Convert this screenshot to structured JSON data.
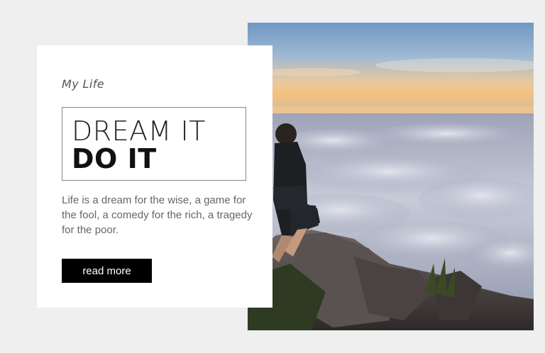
{
  "card": {
    "eyebrow": "My Life",
    "title_line1": "DREAM IT",
    "title_line2": "DO IT",
    "body": "Life is a dream for the wise, a game for the fool, a comedy for the rich, a tragedy for the poor.",
    "button_label": "read more"
  },
  "colors": {
    "page_bg": "#efefef",
    "card_bg": "#ffffff",
    "button_bg": "#000000",
    "button_text": "#ffffff"
  }
}
